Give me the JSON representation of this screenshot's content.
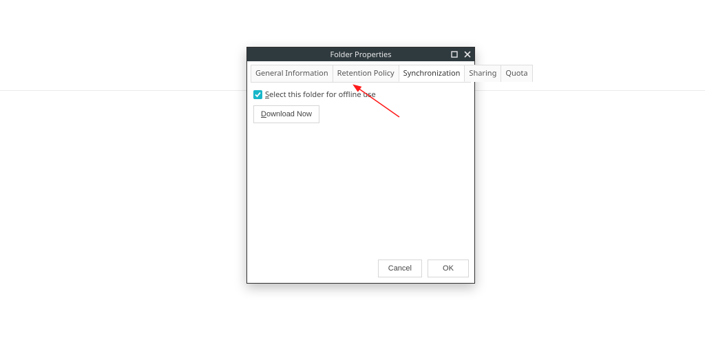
{
  "dialog": {
    "title": "Folder Properties",
    "tabs": [
      {
        "label": "General Information"
      },
      {
        "label": "Retention Policy"
      },
      {
        "label": "Synchronization"
      },
      {
        "label": "Sharing"
      },
      {
        "label": "Quota"
      }
    ],
    "activeTabIndex": 2,
    "sync": {
      "checkbox_label_pre": "S",
      "checkbox_label_rest": "elect this folder for offline use",
      "checked": true,
      "download_pre": "D",
      "download_rest": "ownload Now"
    },
    "footer": {
      "cancel": "Cancel",
      "ok": "OK"
    }
  }
}
